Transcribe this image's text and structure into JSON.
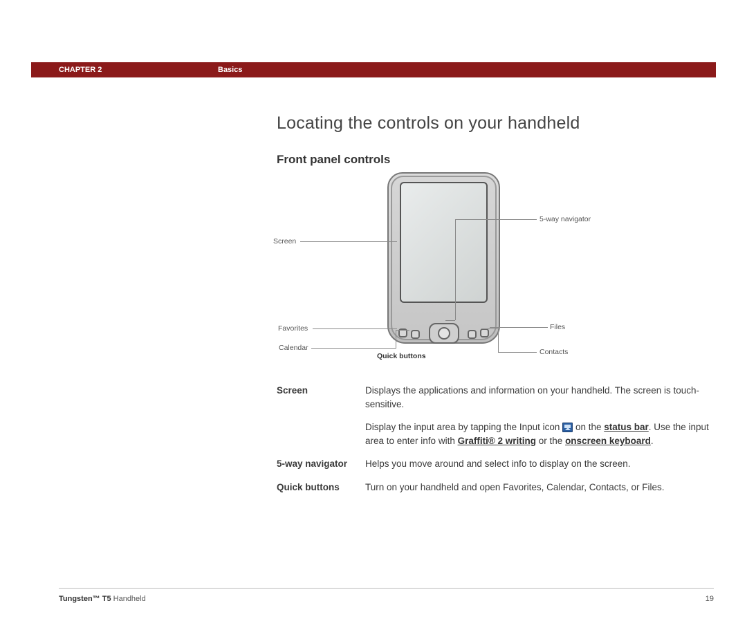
{
  "header": {
    "chapter": "CHAPTER 2",
    "section": "Basics"
  },
  "title": "Locating the controls on your handheld",
  "subtitle": "Front panel controls",
  "diagram": {
    "screen_label": "Screen",
    "favorites_label": "Favorites",
    "calendar_label": "Calendar",
    "quick_label": "Quick buttons",
    "nav_label": "5-way navigator",
    "files_label": "Files",
    "contacts_label": "Contacts"
  },
  "defs": {
    "screen_term": "Screen",
    "screen_p1": "Displays the applications and information on your handheld. The screen is touch-sensitive.",
    "screen_p2a": "Display the input area by tapping the Input icon ",
    "screen_p2b": " on the ",
    "screen_link_status": "status bar",
    "screen_p2c": ". Use the input area to enter info with ",
    "screen_link_graffiti": "Graffiti® 2 writing",
    "screen_p2d": " or the ",
    "screen_link_kbd": "onscreen keyboard",
    "screen_p2e": ".",
    "nav_term": "5-way navigator",
    "nav_body": "Helps you move around and select info to display on the screen.",
    "quick_term": "Quick buttons",
    "quick_body": "Turn on your handheld and open Favorites, Calendar, Contacts, or Files."
  },
  "footer": {
    "product_bold": "Tungsten™ T5",
    "product_rest": " Handheld",
    "page": "19"
  }
}
